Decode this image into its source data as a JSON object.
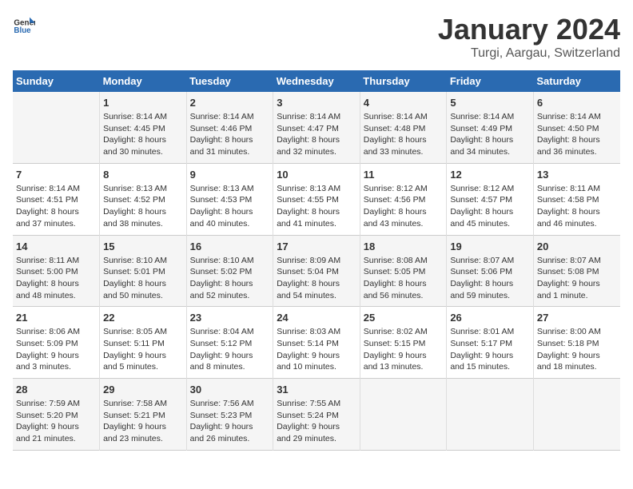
{
  "logo": {
    "general": "General",
    "blue": "Blue"
  },
  "title": "January 2024",
  "subtitle": "Turgi, Aargau, Switzerland",
  "weekdays": [
    "Sunday",
    "Monday",
    "Tuesday",
    "Wednesday",
    "Thursday",
    "Friday",
    "Saturday"
  ],
  "weeks": [
    [
      {
        "day": "",
        "info": ""
      },
      {
        "day": "1",
        "info": "Sunrise: 8:14 AM\nSunset: 4:45 PM\nDaylight: 8 hours\nand 30 minutes."
      },
      {
        "day": "2",
        "info": "Sunrise: 8:14 AM\nSunset: 4:46 PM\nDaylight: 8 hours\nand 31 minutes."
      },
      {
        "day": "3",
        "info": "Sunrise: 8:14 AM\nSunset: 4:47 PM\nDaylight: 8 hours\nand 32 minutes."
      },
      {
        "day": "4",
        "info": "Sunrise: 8:14 AM\nSunset: 4:48 PM\nDaylight: 8 hours\nand 33 minutes."
      },
      {
        "day": "5",
        "info": "Sunrise: 8:14 AM\nSunset: 4:49 PM\nDaylight: 8 hours\nand 34 minutes."
      },
      {
        "day": "6",
        "info": "Sunrise: 8:14 AM\nSunset: 4:50 PM\nDaylight: 8 hours\nand 36 minutes."
      }
    ],
    [
      {
        "day": "7",
        "info": "Sunrise: 8:14 AM\nSunset: 4:51 PM\nDaylight: 8 hours\nand 37 minutes."
      },
      {
        "day": "8",
        "info": "Sunrise: 8:13 AM\nSunset: 4:52 PM\nDaylight: 8 hours\nand 38 minutes."
      },
      {
        "day": "9",
        "info": "Sunrise: 8:13 AM\nSunset: 4:53 PM\nDaylight: 8 hours\nand 40 minutes."
      },
      {
        "day": "10",
        "info": "Sunrise: 8:13 AM\nSunset: 4:55 PM\nDaylight: 8 hours\nand 41 minutes."
      },
      {
        "day": "11",
        "info": "Sunrise: 8:12 AM\nSunset: 4:56 PM\nDaylight: 8 hours\nand 43 minutes."
      },
      {
        "day": "12",
        "info": "Sunrise: 8:12 AM\nSunset: 4:57 PM\nDaylight: 8 hours\nand 45 minutes."
      },
      {
        "day": "13",
        "info": "Sunrise: 8:11 AM\nSunset: 4:58 PM\nDaylight: 8 hours\nand 46 minutes."
      }
    ],
    [
      {
        "day": "14",
        "info": "Sunrise: 8:11 AM\nSunset: 5:00 PM\nDaylight: 8 hours\nand 48 minutes."
      },
      {
        "day": "15",
        "info": "Sunrise: 8:10 AM\nSunset: 5:01 PM\nDaylight: 8 hours\nand 50 minutes."
      },
      {
        "day": "16",
        "info": "Sunrise: 8:10 AM\nSunset: 5:02 PM\nDaylight: 8 hours\nand 52 minutes."
      },
      {
        "day": "17",
        "info": "Sunrise: 8:09 AM\nSunset: 5:04 PM\nDaylight: 8 hours\nand 54 minutes."
      },
      {
        "day": "18",
        "info": "Sunrise: 8:08 AM\nSunset: 5:05 PM\nDaylight: 8 hours\nand 56 minutes."
      },
      {
        "day": "19",
        "info": "Sunrise: 8:07 AM\nSunset: 5:06 PM\nDaylight: 8 hours\nand 59 minutes."
      },
      {
        "day": "20",
        "info": "Sunrise: 8:07 AM\nSunset: 5:08 PM\nDaylight: 9 hours\nand 1 minute."
      }
    ],
    [
      {
        "day": "21",
        "info": "Sunrise: 8:06 AM\nSunset: 5:09 PM\nDaylight: 9 hours\nand 3 minutes."
      },
      {
        "day": "22",
        "info": "Sunrise: 8:05 AM\nSunset: 5:11 PM\nDaylight: 9 hours\nand 5 minutes."
      },
      {
        "day": "23",
        "info": "Sunrise: 8:04 AM\nSunset: 5:12 PM\nDaylight: 9 hours\nand 8 minutes."
      },
      {
        "day": "24",
        "info": "Sunrise: 8:03 AM\nSunset: 5:14 PM\nDaylight: 9 hours\nand 10 minutes."
      },
      {
        "day": "25",
        "info": "Sunrise: 8:02 AM\nSunset: 5:15 PM\nDaylight: 9 hours\nand 13 minutes."
      },
      {
        "day": "26",
        "info": "Sunrise: 8:01 AM\nSunset: 5:17 PM\nDaylight: 9 hours\nand 15 minutes."
      },
      {
        "day": "27",
        "info": "Sunrise: 8:00 AM\nSunset: 5:18 PM\nDaylight: 9 hours\nand 18 minutes."
      }
    ],
    [
      {
        "day": "28",
        "info": "Sunrise: 7:59 AM\nSunset: 5:20 PM\nDaylight: 9 hours\nand 21 minutes."
      },
      {
        "day": "29",
        "info": "Sunrise: 7:58 AM\nSunset: 5:21 PM\nDaylight: 9 hours\nand 23 minutes."
      },
      {
        "day": "30",
        "info": "Sunrise: 7:56 AM\nSunset: 5:23 PM\nDaylight: 9 hours\nand 26 minutes."
      },
      {
        "day": "31",
        "info": "Sunrise: 7:55 AM\nSunset: 5:24 PM\nDaylight: 9 hours\nand 29 minutes."
      },
      {
        "day": "",
        "info": ""
      },
      {
        "day": "",
        "info": ""
      },
      {
        "day": "",
        "info": ""
      }
    ]
  ]
}
